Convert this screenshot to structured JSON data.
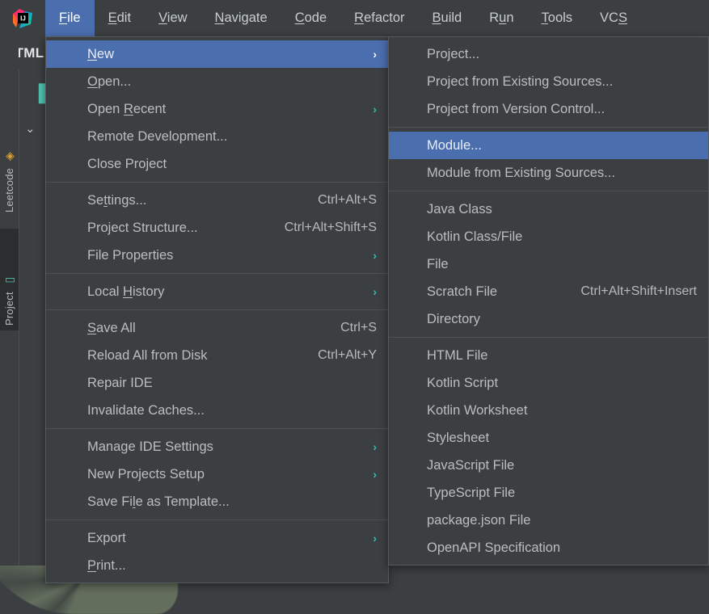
{
  "app": {
    "logo_icon": "intellij-idea-logo",
    "title": "IntelliJ IDEA"
  },
  "menubar": {
    "items": [
      {
        "label": "File",
        "mnemonic": "F",
        "active": true
      },
      {
        "label": "Edit",
        "mnemonic": "E",
        "active": false
      },
      {
        "label": "View",
        "mnemonic": "V",
        "active": false
      },
      {
        "label": "Navigate",
        "mnemonic": "N",
        "active": false
      },
      {
        "label": "Code",
        "mnemonic": "C",
        "active": false
      },
      {
        "label": "Refactor",
        "mnemonic": "R",
        "active": false
      },
      {
        "label": "Build",
        "mnemonic": "B",
        "active": false
      },
      {
        "label": "Run",
        "mnemonic": "u",
        "active": false
      },
      {
        "label": "Tools",
        "mnemonic": "T",
        "active": false
      },
      {
        "label": "VCS",
        "mnemonic": "S",
        "active": false
      }
    ]
  },
  "editor": {
    "tab_label": "HTML",
    "book_icon": "book-icon",
    "collapse_icon": "chevron-down-icon"
  },
  "sidebar": {
    "tools": [
      {
        "label": "Leetcode",
        "icon": "leetcode-icon",
        "active": false
      },
      {
        "label": "Project",
        "icon": "project-monitor-icon",
        "active": true
      }
    ]
  },
  "file_menu": {
    "groups": [
      {
        "items": [
          {
            "label": "New",
            "mnemonic": "N",
            "submenu": true,
            "selected": true,
            "shortcut": ""
          },
          {
            "label": "Open...",
            "mnemonic": "O",
            "submenu": false,
            "selected": false,
            "shortcut": ""
          },
          {
            "label": "Open Recent",
            "mnemonic": "R",
            "submenu": true,
            "selected": false,
            "shortcut": ""
          },
          {
            "label": "Remote Development...",
            "mnemonic": "",
            "submenu": false,
            "selected": false,
            "shortcut": ""
          },
          {
            "label": "Close Project",
            "mnemonic": "",
            "submenu": false,
            "selected": false,
            "shortcut": ""
          }
        ]
      },
      {
        "items": [
          {
            "label": "Settings...",
            "mnemonic": "t",
            "submenu": false,
            "selected": false,
            "shortcut": "Ctrl+Alt+S"
          },
          {
            "label": "Project Structure...",
            "mnemonic": "",
            "submenu": false,
            "selected": false,
            "shortcut": "Ctrl+Alt+Shift+S"
          },
          {
            "label": "File Properties",
            "mnemonic": "",
            "submenu": true,
            "selected": false,
            "shortcut": ""
          }
        ]
      },
      {
        "items": [
          {
            "label": "Local History",
            "mnemonic": "H",
            "submenu": true,
            "selected": false,
            "shortcut": ""
          }
        ]
      },
      {
        "items": [
          {
            "label": "Save All",
            "mnemonic": "S",
            "submenu": false,
            "selected": false,
            "shortcut": "Ctrl+S"
          },
          {
            "label": "Reload All from Disk",
            "mnemonic": "",
            "submenu": false,
            "selected": false,
            "shortcut": "Ctrl+Alt+Y"
          },
          {
            "label": "Repair IDE",
            "mnemonic": "",
            "submenu": false,
            "selected": false,
            "shortcut": ""
          },
          {
            "label": "Invalidate Caches...",
            "mnemonic": "",
            "submenu": false,
            "selected": false,
            "shortcut": ""
          }
        ]
      },
      {
        "items": [
          {
            "label": "Manage IDE Settings",
            "mnemonic": "",
            "submenu": true,
            "selected": false,
            "shortcut": ""
          },
          {
            "label": "New Projects Setup",
            "mnemonic": "",
            "submenu": true,
            "selected": false,
            "shortcut": ""
          },
          {
            "label": "Save File as Template...",
            "mnemonic": "l",
            "submenu": false,
            "selected": false,
            "shortcut": ""
          }
        ]
      },
      {
        "items": [
          {
            "label": "Export",
            "mnemonic": "",
            "submenu": true,
            "selected": false,
            "shortcut": ""
          },
          {
            "label": "Print...",
            "mnemonic": "P",
            "submenu": false,
            "selected": false,
            "shortcut": ""
          }
        ]
      }
    ]
  },
  "new_submenu": {
    "groups": [
      {
        "items": [
          {
            "label": "Project...",
            "selected": false,
            "shortcut": ""
          },
          {
            "label": "Project from Existing Sources...",
            "selected": false,
            "shortcut": ""
          },
          {
            "label": "Project from Version Control...",
            "selected": false,
            "shortcut": ""
          }
        ]
      },
      {
        "items": [
          {
            "label": "Module...",
            "selected": true,
            "shortcut": ""
          },
          {
            "label": "Module from Existing Sources...",
            "selected": false,
            "shortcut": ""
          }
        ]
      },
      {
        "items": [
          {
            "label": "Java Class",
            "selected": false,
            "shortcut": ""
          },
          {
            "label": "Kotlin Class/File",
            "selected": false,
            "shortcut": ""
          },
          {
            "label": "File",
            "selected": false,
            "shortcut": ""
          },
          {
            "label": "Scratch File",
            "selected": false,
            "shortcut": "Ctrl+Alt+Shift+Insert"
          },
          {
            "label": "Directory",
            "selected": false,
            "shortcut": ""
          }
        ]
      },
      {
        "items": [
          {
            "label": "HTML File",
            "selected": false,
            "shortcut": ""
          },
          {
            "label": "Kotlin Script",
            "selected": false,
            "shortcut": ""
          },
          {
            "label": "Kotlin Worksheet",
            "selected": false,
            "shortcut": ""
          },
          {
            "label": "Stylesheet",
            "selected": false,
            "shortcut": ""
          },
          {
            "label": "JavaScript File",
            "selected": false,
            "shortcut": ""
          },
          {
            "label": "TypeScript File",
            "selected": false,
            "shortcut": ""
          },
          {
            "label": "package.json File",
            "selected": false,
            "shortcut": ""
          },
          {
            "label": "OpenAPI Specification",
            "selected": false,
            "shortcut": ""
          }
        ]
      }
    ]
  },
  "colors": {
    "menu_background": "#3c3f41",
    "selection_blue": "#4b6eaf",
    "submenu_arrow_teal": "#30bfb3",
    "text": "#bdbdbd",
    "separator": "#4f5254"
  }
}
